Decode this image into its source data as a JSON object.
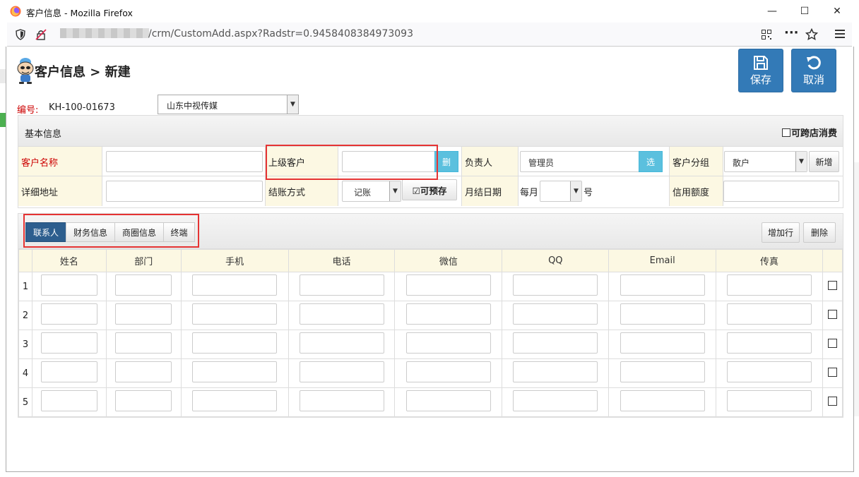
{
  "window": {
    "title": "客户信息 - Mozilla Firefox",
    "url_visible": "/crm/CustomAdd.aspx?Radstr=0.9458408384973093",
    "controls": {
      "minimize": "—",
      "maximize": "☐",
      "close": "✕"
    }
  },
  "header": {
    "title": "客户信息 > 新建",
    "code_label": "编号:",
    "code_value": "KH-100-01673",
    "company": "山东中视传媒",
    "save_label": "保存",
    "cancel_label": "取消"
  },
  "basic": {
    "title": "基本信息",
    "cross_store": "可跨店消费",
    "customer_name_label": "客户名称",
    "parent_label": "上级客户",
    "parent_delete": "删",
    "owner_label": "负责人",
    "owner_value": "管理员",
    "owner_select": "选",
    "group_label": "客户分组",
    "group_value": "散户",
    "group_new": "新增",
    "address_label": "详细地址",
    "settle_label": "结账方式",
    "settle_value": "记账",
    "prepay": "☑可预存",
    "monthly_label": "月结日期",
    "monthly_prefix": "每月",
    "monthly_suffix": "号",
    "credit_label": "信用额度"
  },
  "contacts": {
    "tabs": [
      "联系人",
      "财务信息",
      "商圈信息",
      "终端"
    ],
    "add_row": "增加行",
    "delete": "删除",
    "columns": [
      "姓名",
      "部门",
      "手机",
      "电话",
      "微信",
      "QQ",
      "Email",
      "传真"
    ],
    "rows": [
      "1",
      "2",
      "3",
      "4",
      "5"
    ]
  }
}
